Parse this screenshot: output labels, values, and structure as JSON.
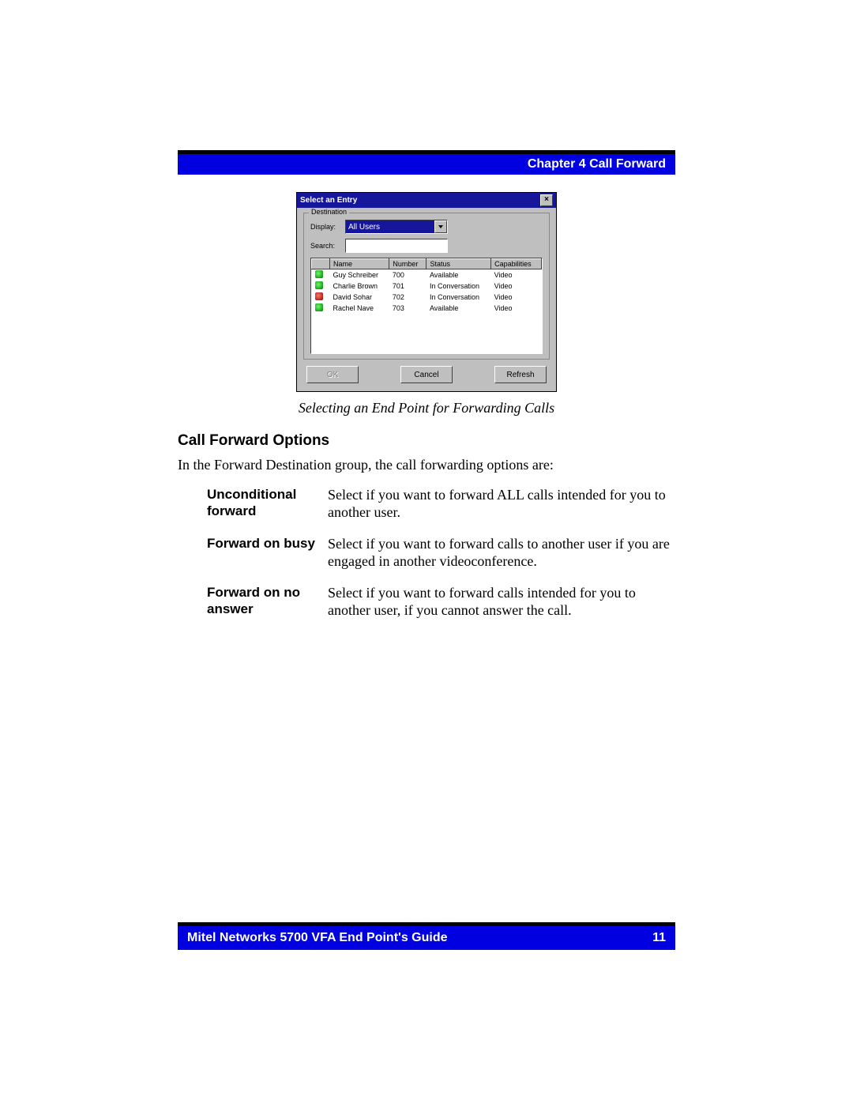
{
  "header": {
    "chapter": "Chapter 4 Call Forward"
  },
  "dialog": {
    "title": "Select an Entry",
    "groupLegend": "Destination",
    "displayLabel": "Display:",
    "displayValue": "All Users",
    "searchLabel": "Search:",
    "columns": {
      "name": "Name",
      "number": "Number",
      "status": "Status",
      "capabilities": "Capabilities"
    },
    "rows": [
      {
        "icon": "green",
        "name": "Guy Schreiber",
        "number": "700",
        "status": "Available",
        "cap": "Video"
      },
      {
        "icon": "green",
        "name": "Charlie Brown",
        "number": "701",
        "status": "In Conversation",
        "cap": "Video"
      },
      {
        "icon": "red",
        "name": "David Sohar",
        "number": "702",
        "status": "In Conversation",
        "cap": "Video"
      },
      {
        "icon": "green",
        "name": "Rachel Nave",
        "number": "703",
        "status": "Available",
        "cap": "Video"
      }
    ],
    "buttons": {
      "ok": "OK",
      "cancel": "Cancel",
      "refresh": "Refresh"
    }
  },
  "caption": "Selecting an End Point for Forwarding Calls",
  "section": {
    "title": "Call Forward Options",
    "intro": "In the Forward Destination group, the call forwarding options are:",
    "options": [
      {
        "term": "Unconditional forward",
        "desc": "Select if you want to forward ALL calls intended for you to another user."
      },
      {
        "term": "Forward on busy",
        "desc": "Select if you want to forward calls to another user if you are engaged in another videoconference."
      },
      {
        "term": "Forward on no answer",
        "desc": "Select if you want to forward calls intended for you to another user, if you cannot answer the call."
      }
    ]
  },
  "footer": {
    "guide": "Mitel Networks 5700 VFA End Point's Guide",
    "page": "11"
  }
}
